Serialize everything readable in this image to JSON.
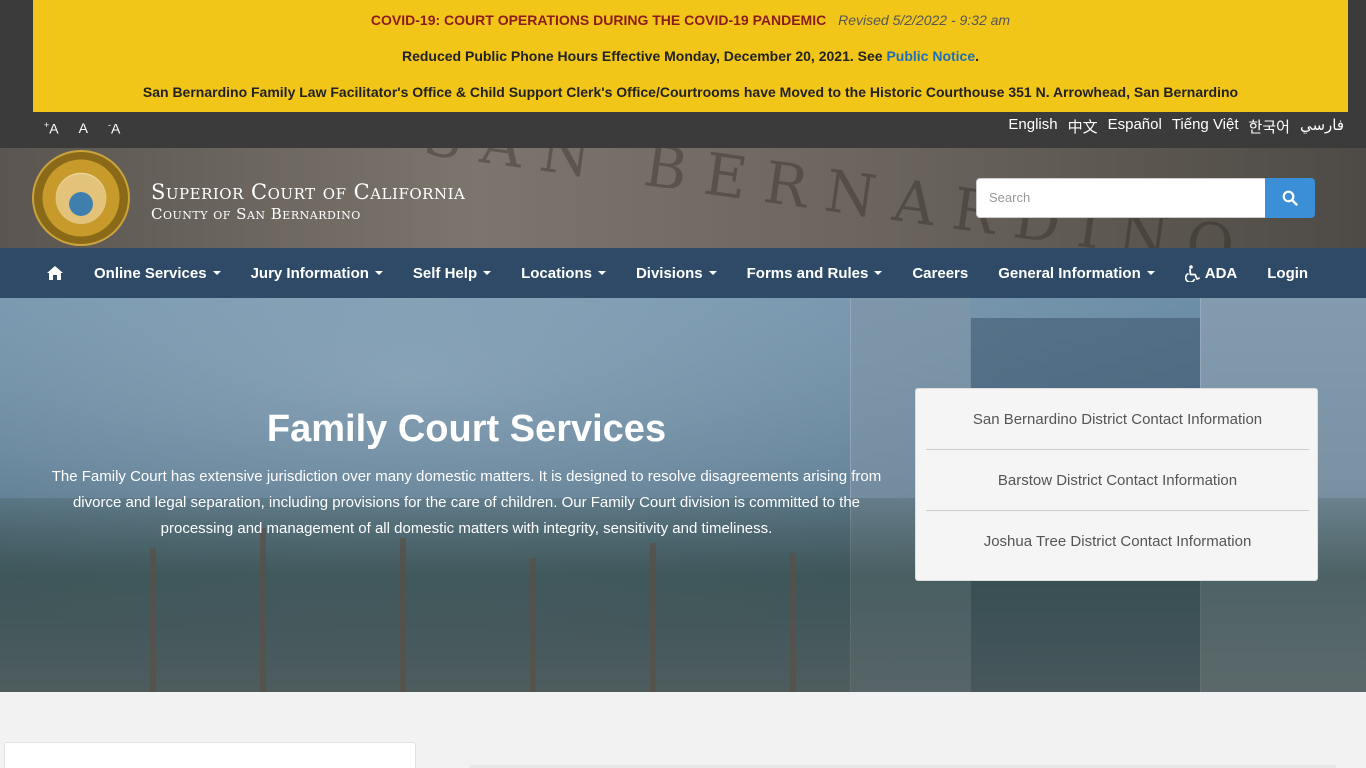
{
  "alert": {
    "line1": "COVID-19: COURT OPERATIONS DURING THE COVID-19 PANDEMIC",
    "line1_revised": "Revised 5/2/2022 - 9:32 am",
    "line2_text": "Reduced Public Phone Hours Effective Monday, December 20, 2021. See",
    "line2_link": "Public Notice",
    "line2_end": ".",
    "line3": "San Bernardino Family Law Facilitator's Office & Child Support Clerk's Office/Courtrooms have Moved to the Historic Courthouse 351 N. Arrowhead, San Bernardino"
  },
  "font_controls": {
    "increase": "A",
    "increase_sign": "+",
    "normal": "A",
    "decrease": "A",
    "decrease_sign": "-"
  },
  "languages": [
    "English",
    "中文",
    "Español",
    "Tiếng Việt",
    "한국어",
    "فارسي"
  ],
  "header": {
    "title": "Superior Court of California",
    "subtitle": "County of San Bernardino",
    "search_placeholder": "Search"
  },
  "nav": {
    "items": [
      {
        "label": "Online Services",
        "dropdown": true
      },
      {
        "label": "Jury Information",
        "dropdown": true
      },
      {
        "label": "Self Help",
        "dropdown": true
      },
      {
        "label": "Locations",
        "dropdown": true
      },
      {
        "label": "Divisions",
        "dropdown": true
      },
      {
        "label": "Forms and Rules",
        "dropdown": true
      },
      {
        "label": "Careers",
        "dropdown": false
      },
      {
        "label": "General Information",
        "dropdown": true
      },
      {
        "label": "ADA",
        "dropdown": false
      },
      {
        "label": "Login",
        "dropdown": false
      }
    ]
  },
  "hero": {
    "title": "Family Court Services",
    "description": "The Family Court has extensive jurisdiction over many domestic matters. It is designed to resolve disagreements arising from divorce and legal separation, including provisions for the care of children. Our Family Court division is committed to the processing and management of all domestic matters with integrity, sensitivity and timeliness."
  },
  "contacts": [
    "San Bernardino District Contact Information",
    "Barstow District Contact Information",
    "Joshua Tree District Contact Information"
  ],
  "colors": {
    "alert_bg": "#f2c618",
    "alert_title": "#8b1c1c",
    "link": "#1f6fb8",
    "nav_bg": "#2f4a66",
    "search_button": "#3b8fd6",
    "utility_bg": "#3b3b3b"
  },
  "icons": {
    "home": "home-icon",
    "ada": "wheelchair-icon",
    "search": "search-icon",
    "seal": "court-seal"
  }
}
